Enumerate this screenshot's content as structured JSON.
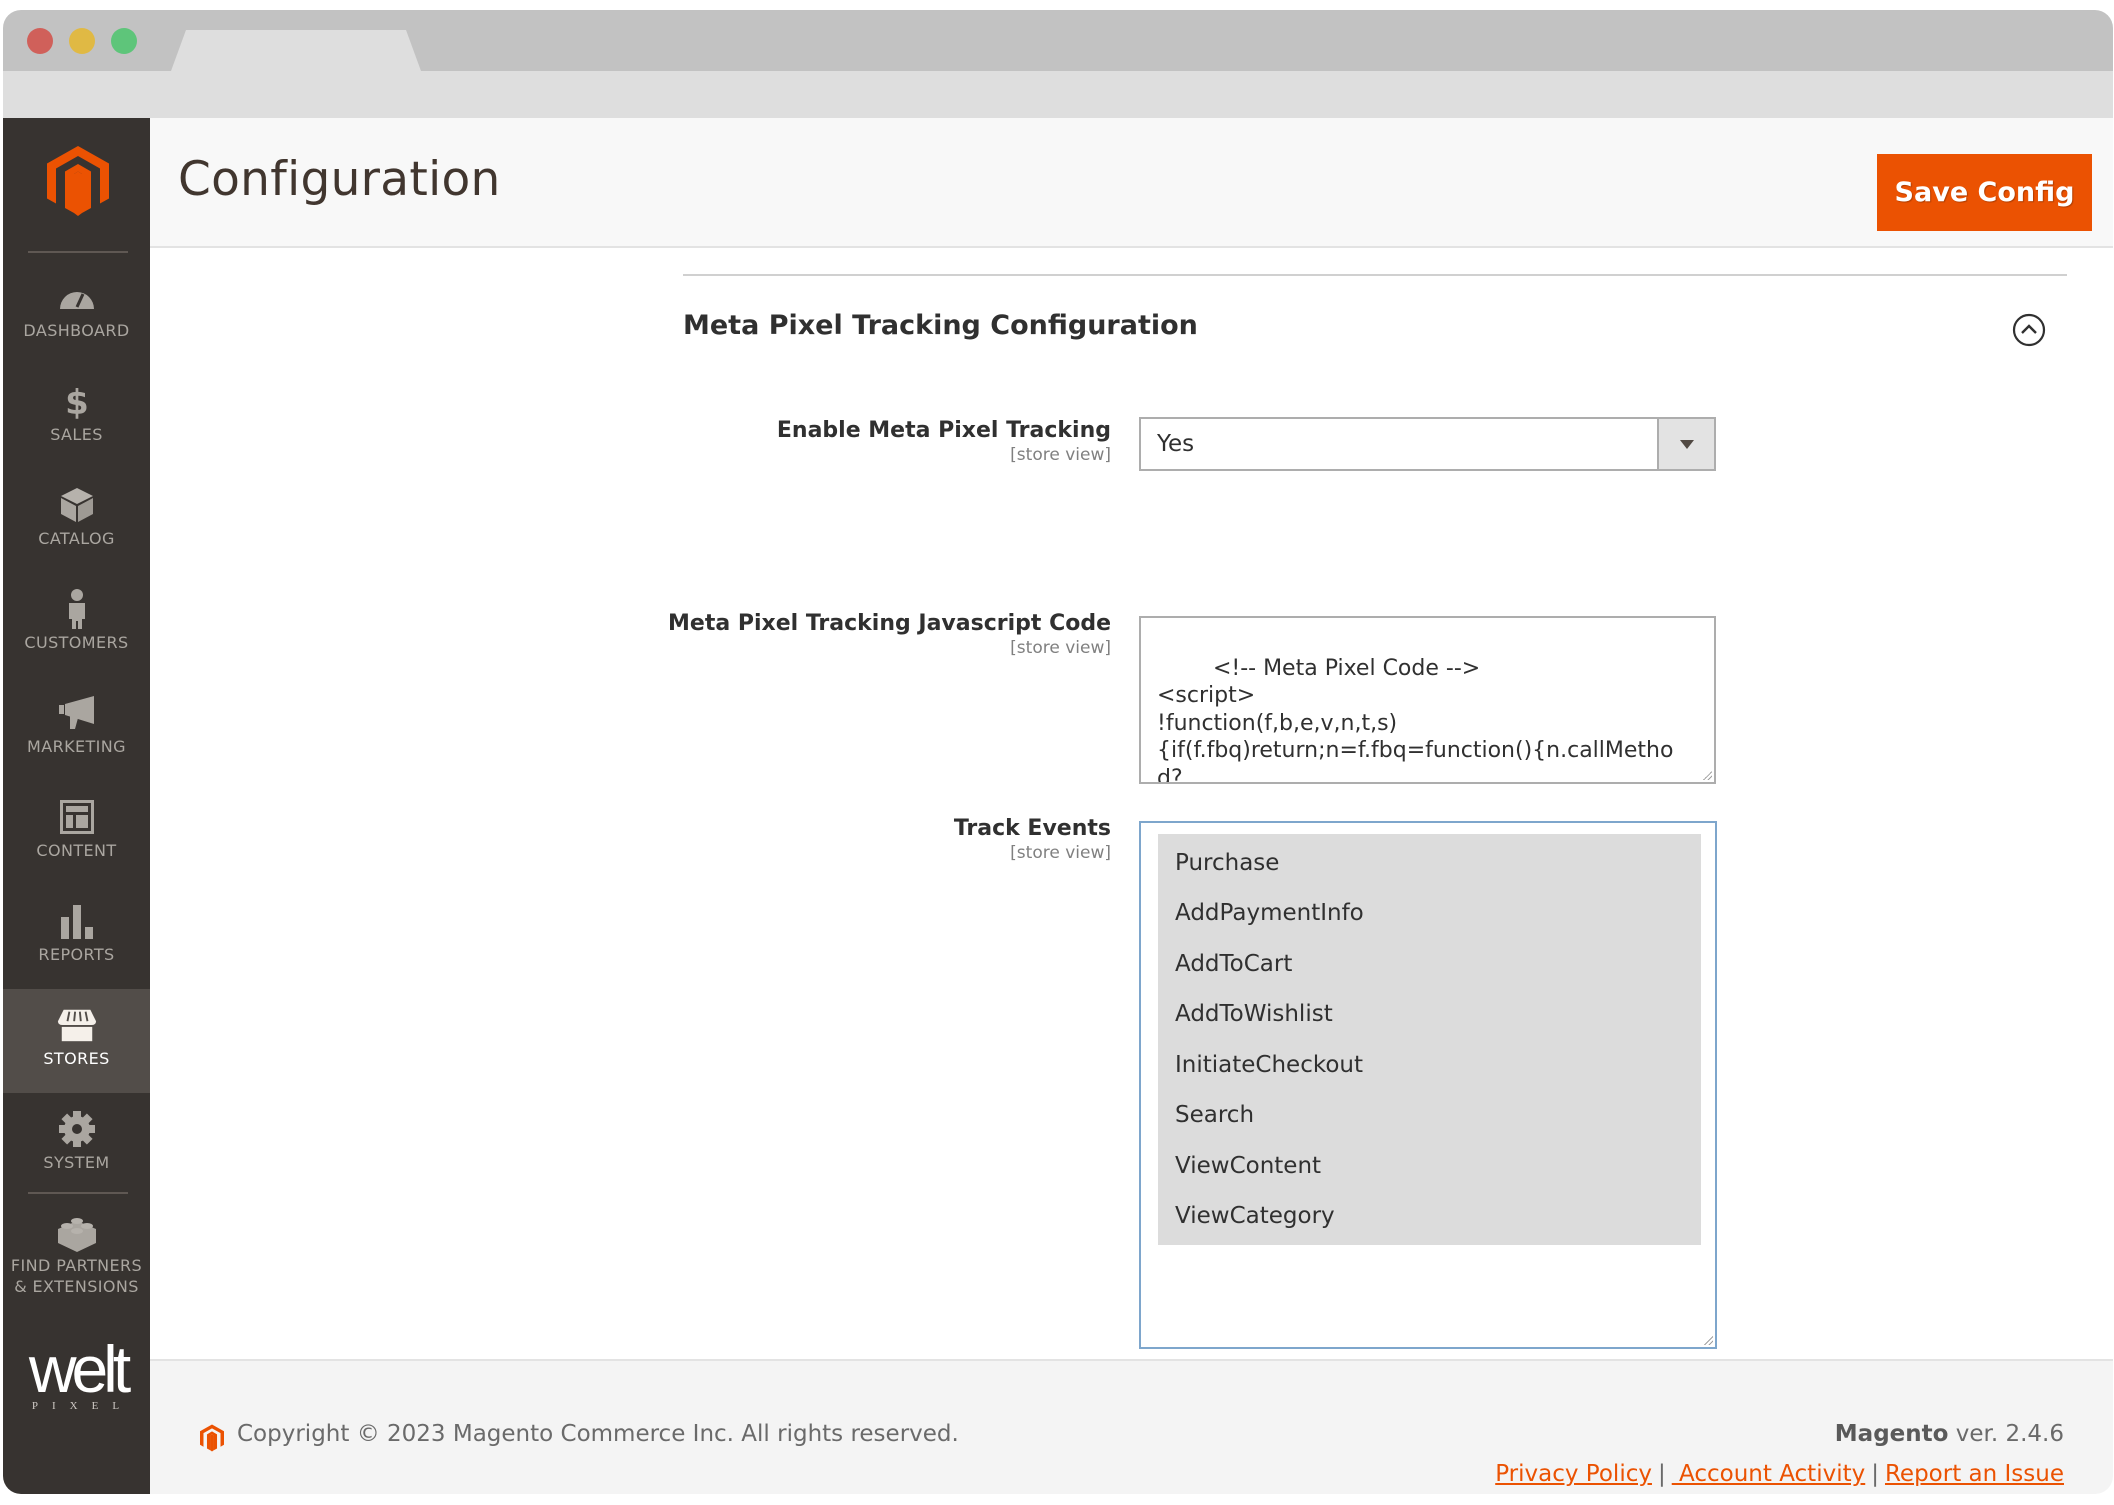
{
  "browser": {
    "tab_title": ""
  },
  "sidebar": {
    "items": [
      {
        "label": "DASHBOARD",
        "icon": "dashboard-gauge-icon"
      },
      {
        "label": "SALES",
        "icon": "dollar-icon"
      },
      {
        "label": "CATALOG",
        "icon": "box-icon"
      },
      {
        "label": "CUSTOMERS",
        "icon": "person-icon"
      },
      {
        "label": "MARKETING",
        "icon": "megaphone-icon"
      },
      {
        "label": "CONTENT",
        "icon": "layout-icon"
      },
      {
        "label": "REPORTS",
        "icon": "bar-chart-icon"
      },
      {
        "label": "STORES",
        "icon": "storefront-icon",
        "active": true
      },
      {
        "label": "SYSTEM",
        "icon": "gear-icon"
      },
      {
        "label_line1": "FIND PARTNERS",
        "label_line2": "& EXTENSIONS",
        "icon": "lego-brick-icon"
      }
    ],
    "brand": {
      "word": "welt",
      "sub": "PIXEL"
    }
  },
  "header": {
    "title": "Configuration",
    "save_label": "Save Config"
  },
  "section": {
    "title": "Meta Pixel Tracking Configuration",
    "fields": {
      "enable": {
        "label": "Enable Meta Pixel Tracking",
        "scope": "[store view]",
        "value": "Yes"
      },
      "code": {
        "label": "Meta Pixel Tracking Javascript Code",
        "scope": "[store view]",
        "value": "<!-- Meta Pixel Code -->\n<script>\n!function(f,b,e,v,n,t,s)\n{if(f.fbq)return;n=f.fbq=function(){n.callMethod?\nn.callMethod.apply(n,arguments):n.queue.push(\narguments)};"
      },
      "events": {
        "label": "Track Events",
        "scope": "[store view]",
        "options": [
          "Purchase",
          "AddPaymentInfo",
          "AddToCart",
          "AddToWishlist",
          "InitiateCheckout",
          "Search",
          "ViewContent",
          "ViewCategory"
        ],
        "selected": [
          "Purchase",
          "AddPaymentInfo",
          "AddToCart",
          "AddToWishlist",
          "InitiateCheckout",
          "Search",
          "ViewContent",
          "ViewCategory"
        ]
      }
    }
  },
  "footer": {
    "copyright": "Copyright © 2023 Magento Commerce Inc. All rights reserved.",
    "brand": "Magento",
    "version": " ver. 2.4.6",
    "links": [
      "Privacy Policy",
      " Account Activity",
      "Report an Issue"
    ],
    "separator": "|"
  },
  "colors": {
    "accent": "#eb5202",
    "sidebar_bg": "#373330",
    "sidebar_active": "#524d49"
  }
}
